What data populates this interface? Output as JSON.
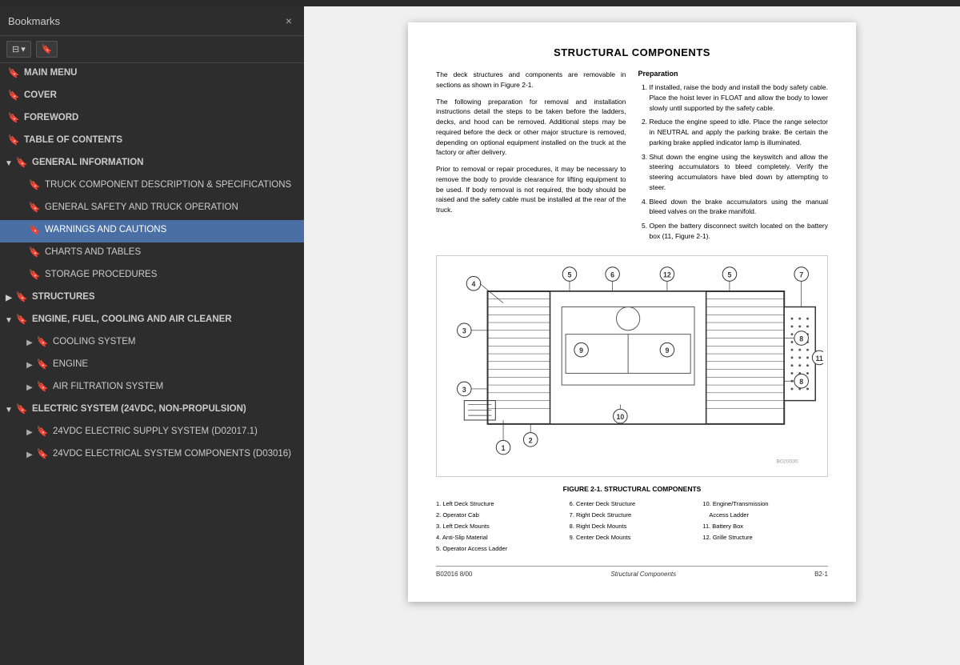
{
  "sidebar": {
    "title": "Bookmarks",
    "close_label": "×",
    "items": [
      {
        "id": "main-menu",
        "level": 1,
        "label": "MAIN MENU",
        "expand": null,
        "active": false
      },
      {
        "id": "cover",
        "level": 1,
        "label": "COVER",
        "expand": null,
        "active": false
      },
      {
        "id": "foreword",
        "level": 1,
        "label": "FOREWORD",
        "expand": null,
        "active": false
      },
      {
        "id": "toc",
        "level": 1,
        "label": "TABLE OF CONTENTS",
        "expand": null,
        "active": false
      },
      {
        "id": "general-info",
        "level": 1,
        "label": "GENERAL INFORMATION",
        "expand": "open",
        "active": false
      },
      {
        "id": "truck-component",
        "level": 2,
        "label": "TRUCK COMPONENT DESCRIPTION & SPECIFICATIONS",
        "expand": null,
        "active": false
      },
      {
        "id": "general-safety",
        "level": 2,
        "label": "GENERAL SAFETY AND TRUCK OPERATION",
        "expand": null,
        "active": false
      },
      {
        "id": "warnings",
        "level": 2,
        "label": "WARNINGS AND CAUTIONS",
        "expand": null,
        "active": true
      },
      {
        "id": "charts-tables",
        "level": 2,
        "label": "CHARTS AND TABLES",
        "expand": null,
        "active": false
      },
      {
        "id": "storage",
        "level": 2,
        "label": "STORAGE PROCEDURES",
        "expand": null,
        "active": false
      },
      {
        "id": "structures",
        "level": 1,
        "label": "STRUCTURES",
        "expand": "closed",
        "active": false
      },
      {
        "id": "engine-fuel",
        "level": 1,
        "label": "ENGINE, FUEL, COOLING AND AIR CLEANER",
        "expand": "open",
        "active": false
      },
      {
        "id": "cooling-system",
        "level": 2,
        "label": "COOLING SYSTEM",
        "expand": "closed",
        "active": false
      },
      {
        "id": "engine",
        "level": 2,
        "label": "ENGINE",
        "expand": "closed",
        "active": false
      },
      {
        "id": "air-filtration",
        "level": 2,
        "label": "AIR FILTRATION SYSTEM",
        "expand": "closed",
        "active": false
      },
      {
        "id": "electric-system",
        "level": 1,
        "label": "ELECTRIC SYSTEM (24VDC, NON-PROPULSION)",
        "expand": "open",
        "active": false
      },
      {
        "id": "24vdc-supply",
        "level": 2,
        "label": "24VDC ELECTRIC SUPPLY SYSTEM (D02017.1)",
        "expand": "closed",
        "active": false
      },
      {
        "id": "24vdc-electrical",
        "level": 2,
        "label": "24VDC ELECTRICAL SYSTEM COMPONENTS (D03016)",
        "expand": "closed",
        "active": false
      }
    ]
  },
  "content": {
    "page_title": "STRUCTURAL COMPONENTS",
    "intro_paragraphs": [
      "The deck structures and components are removable in sections as shown in Figure 2-1.",
      "The following preparation for removal and installation instructions detail the steps to be taken before the ladders, decks, and hood can be removed. Additional steps may be required before the deck or other major structure is removed, depending on optional equipment installed on the truck at the factory or after delivery.",
      "Prior to removal or repair procedures, it may be necessary to remove the body to provide clearance for lifting equipment to be used. If body removal is not required, the body should be raised and the safety cable must be installed at the rear of the truck."
    ],
    "prep_title": "Preparation",
    "prep_steps": [
      "If installed, raise the body and install the body safety cable. Place the hoist lever in FLOAT and allow the body to lower slowly until supported by the safety cable.",
      "Reduce the engine speed to idle. Place the range selector in NEUTRAL and apply the parking brake. Be certain the parking brake applied indicator lamp is illuminated.",
      "Shut down the engine using the keyswitch and allow the steering accumulators to bleed completely. Verify the steering accumulators have bled down by attempting to steer.",
      "Bleed down the brake accumulators using the manual bleed valves on the brake manifold.",
      "Open the battery disconnect switch located on the battery box (11, Figure 2-1)."
    ],
    "figure_caption": "FIGURE 2-1. STRUCTURAL COMPONENTS",
    "legend_items": [
      "1. Left Deck Structure",
      "2. Operator Cab",
      "3. Left Deck Mounts",
      "4. Anti-Slip Material",
      "5. Operator Access Ladder",
      "6. Center Deck Structure",
      "7. Right Deck Structure",
      "8. Right Deck Mounts",
      "9. Center Deck Mounts",
      "10. Engine/Transmission Access Ladder",
      "11. Battery Box",
      "12. Grille Structure"
    ],
    "footer_left": "B02016 8/00",
    "footer_center": "Structural Components",
    "footer_right": "B2-1"
  }
}
